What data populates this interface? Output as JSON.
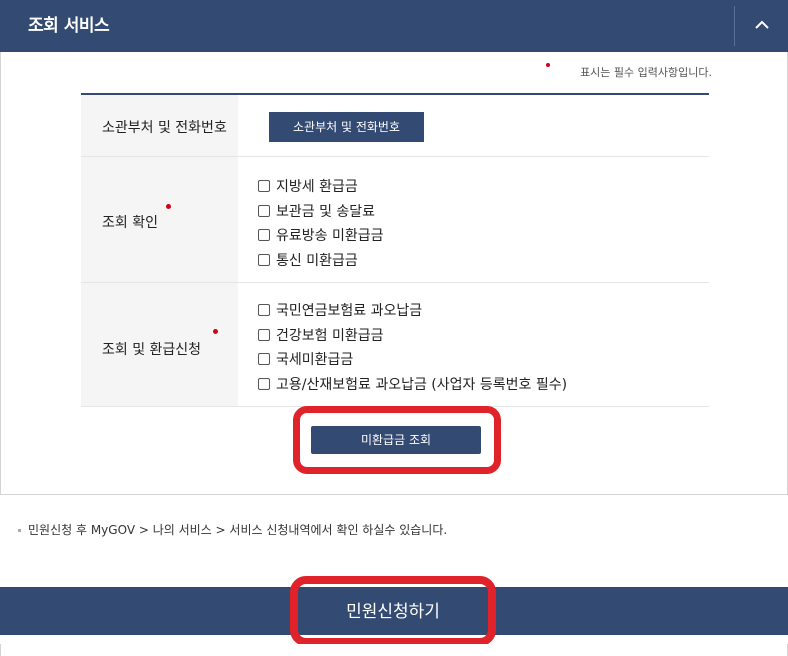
{
  "header": {
    "title": "조회 서비스",
    "collapse_icon": "chevron-up-icon"
  },
  "required_note": "표시는 필수 입력사항입니다.",
  "form": {
    "department": {
      "label": "소관부처 및 전화번호",
      "button_label": "소관부처 및 전화번호"
    },
    "inquiry": {
      "label": "조회 확인",
      "options": [
        "지방세 환급금",
        "보관금 및 송달료",
        "유료방송 미환급금",
        "통신 미환급금"
      ]
    },
    "inquiry_refund": {
      "label": "조회 및 환급신청",
      "options": [
        "국민연금보험료 과오납금",
        "건강보험 미환급금",
        "국세미환급금",
        "고용/산재보험료 과오납금 (사업자 등록번호 필수)"
      ]
    }
  },
  "search_button": "미환급금 조회",
  "notice": "민원신청 후 MyGOV > 나의 서비스 > 서비스 신청내역에서 확인 하실수 있습니다.",
  "apply_button": "민원신청하기",
  "colors": {
    "primary": "#334a73",
    "highlight": "#e0232a",
    "required_dot": "#d0021b"
  }
}
